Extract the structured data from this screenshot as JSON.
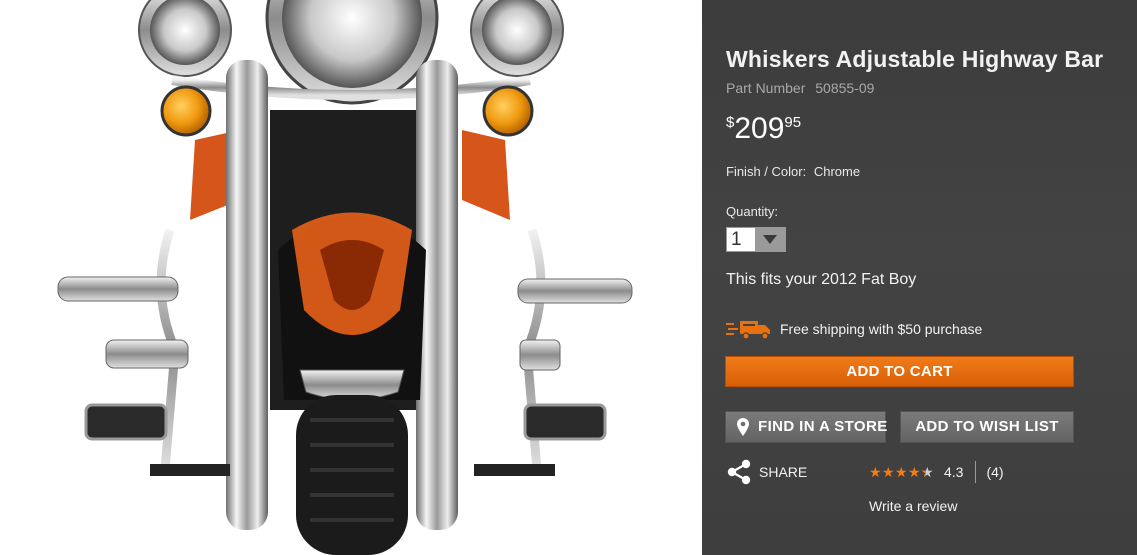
{
  "product": {
    "title": "Whiskers Adjustable Highway Bar",
    "part_label": "Part Number",
    "part_number": "50855-09",
    "price": {
      "currency": "$",
      "dollars": "209",
      "cents": "95"
    },
    "finish_label": "Finish / Color:",
    "finish_value": "Chrome",
    "image_alt": "Chrome highway bar mounted on motorcycle front"
  },
  "quantity": {
    "label": "Quantity:",
    "value": "1"
  },
  "fitment": "This fits your 2012 Fat Boy",
  "shipping": {
    "text": "Free shipping with $50 purchase",
    "icon": "truck-icon"
  },
  "buttons": {
    "add_to_cart": "ADD TO CART",
    "find_store": "FIND IN A STORE",
    "wish_list": "ADD TO WISH LIST"
  },
  "share": {
    "label": "SHARE",
    "icon": "share-icon"
  },
  "rating": {
    "value": "4.3",
    "count": "(4)",
    "stars_filled": 4.3,
    "max": 5
  },
  "review": {
    "link": "Write a review"
  },
  "colors": {
    "accent": "#e8700f",
    "panel": "#404040",
    "button_gray": "#6e6e6e"
  }
}
